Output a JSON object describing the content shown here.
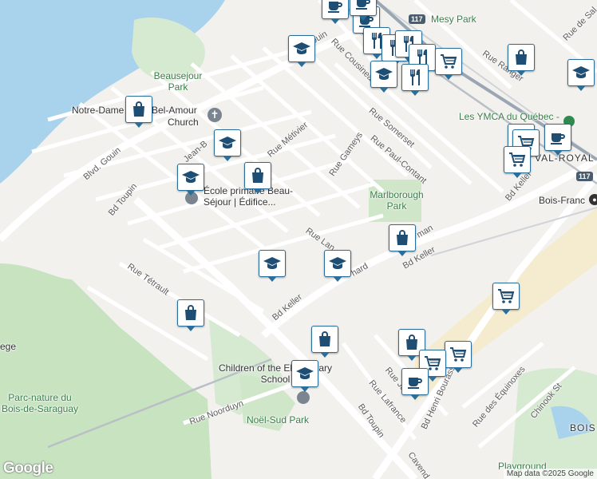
{
  "map": {
    "streets": {
      "blvd_gouin": "Blvd. Gouin",
      "bd_toupin_left": "Bd Toupin",
      "bd_toupin_bottom": "Bd Toupin",
      "rue_tetrault": "Rue Tétrault",
      "bd_keller_left": "Bd Keller",
      "bd_keller_right": "Bd Keller",
      "bd_keller_far": "Bd Keller",
      "rue_metivier": "Rue Métivier",
      "rue_gameys": "Rue Gameys",
      "rue_somerset": "Rue Somerset",
      "rue_paul_contant": "Rue Paul-Contant",
      "rue_cousineau": "Rue Cousineau",
      "rue_ranger": "Rue Ranger",
      "rue_de_sal": "Rue de Sal",
      "rue_lan": "Rue Lan",
      "rue_hard": "hard",
      "rue_man": "man",
      "rue_noorduyn": "Rue Noorduyn",
      "rue_lafrance": "Rue Lafrance",
      "rue_ja": "Rue Ja",
      "rue_des_equinoxes": "Rue des Équinoxes",
      "chinook": "Chinook St",
      "bd_henri_bourassa": "Bd Henri Bourassa",
      "cavend": "Cavend",
      "jean_b": "Jean-B",
      "gouin_e": "ouin"
    },
    "places": {
      "beausejour_park": "Beausejour Park",
      "notre_dame": "Notre-Dame",
      "bel_amour": "Bel-Amour",
      "church": "Church",
      "ecole": "École primaire Beau-Séjour | Édifice...",
      "marlborough_park": "Marlborough Park",
      "ymca": "Les YMCA du Québec -",
      "val_royal": "VAL-ROYAL",
      "bois_franc": "Bois-Franc",
      "children": "Children of the Elementary School",
      "noel_sud_park": "Noël-Sud Park",
      "parc_nature": "Parc-nature du Bois-de-Saraguay",
      "ege": "ege",
      "mesy_park": "Mesy Park",
      "playground": "Playground",
      "bois": "BOIS"
    },
    "shields": [
      "117",
      "117"
    ],
    "branding": "Google",
    "attribution": "Map data ©2025 Google"
  },
  "markers": [
    {
      "type": "cafe",
      "icon": "coffee-cup-icon"
    },
    {
      "type": "cafe",
      "icon": "coffee-cup-icon"
    },
    {
      "type": "cafe",
      "icon": "coffee-cup-icon"
    },
    {
      "type": "school",
      "icon": "graduation-cap-icon"
    },
    {
      "type": "restaurant",
      "icon": "fork-knife-icon"
    },
    {
      "type": "restaurant",
      "icon": "fork-knife-icon"
    },
    {
      "type": "restaurant",
      "icon": "fork-knife-icon"
    },
    {
      "type": "restaurant",
      "icon": "fork-knife-icon"
    },
    {
      "type": "grocery",
      "icon": "shopping-cart-icon"
    },
    {
      "type": "school",
      "icon": "graduation-cap-icon"
    },
    {
      "type": "restaurant",
      "icon": "fork-knife-icon"
    },
    {
      "type": "shopping",
      "icon": "shopping-bag-icon"
    },
    {
      "type": "school",
      "icon": "graduation-cap-icon"
    },
    {
      "type": "shopping",
      "icon": "shopping-bag-icon"
    },
    {
      "type": "school",
      "icon": "graduation-cap-icon"
    },
    {
      "type": "school",
      "icon": "graduation-cap-icon"
    },
    {
      "type": "shopping",
      "icon": "shopping-bag-icon"
    },
    {
      "type": "grocery",
      "icon": "shopping-cart-icon"
    },
    {
      "type": "grocery",
      "icon": "shopping-cart-icon"
    },
    {
      "type": "cafe",
      "icon": "coffee-cup-icon"
    },
    {
      "type": "grocery",
      "icon": "shopping-cart-icon"
    },
    {
      "type": "shopping",
      "icon": "shopping-bag-icon"
    },
    {
      "type": "school",
      "icon": "graduation-cap-icon"
    },
    {
      "type": "school",
      "icon": "graduation-cap-icon"
    },
    {
      "type": "grocery",
      "icon": "shopping-cart-icon"
    },
    {
      "type": "shopping",
      "icon": "shopping-bag-icon"
    },
    {
      "type": "shopping",
      "icon": "shopping-bag-icon"
    },
    {
      "type": "shopping",
      "icon": "shopping-bag-icon"
    },
    {
      "type": "grocery",
      "icon": "shopping-cart-icon"
    },
    {
      "type": "grocery",
      "icon": "shopping-cart-icon"
    },
    {
      "type": "cafe",
      "icon": "coffee-cup-icon"
    },
    {
      "type": "school",
      "icon": "graduation-cap-icon"
    }
  ]
}
